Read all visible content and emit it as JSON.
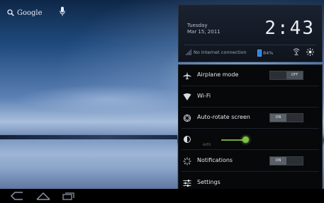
{
  "search": {
    "label": "Google"
  },
  "status": {
    "day": "Tuesday",
    "date": "Mar 15, 2011",
    "time": "2:43",
    "connection": "No Internet connection",
    "battery": "84%"
  },
  "quick_settings": {
    "airplane_mode": {
      "label": "Airplane mode",
      "state": "OFF"
    },
    "wifi": {
      "label": "Wi-Fi"
    },
    "auto_rotate": {
      "label": "Auto-rotate screen",
      "state": "ON"
    },
    "brightness": {
      "auto_label": "AUTO",
      "level": 0.85
    },
    "notifications": {
      "label": "Notifications",
      "state": "ON"
    },
    "settings": {
      "label": "Settings"
    }
  },
  "colors": {
    "accent_blue": "#2f7fd6",
    "slider_green": "#7fc240"
  },
  "icons": [
    "search-icon",
    "mic-icon",
    "signal-icon",
    "wifi-icon",
    "brightness-icon",
    "airplane-icon",
    "rotate-icon",
    "notifications-icon",
    "settings-icon",
    "back-icon",
    "home-icon",
    "recent-apps-icon"
  ]
}
